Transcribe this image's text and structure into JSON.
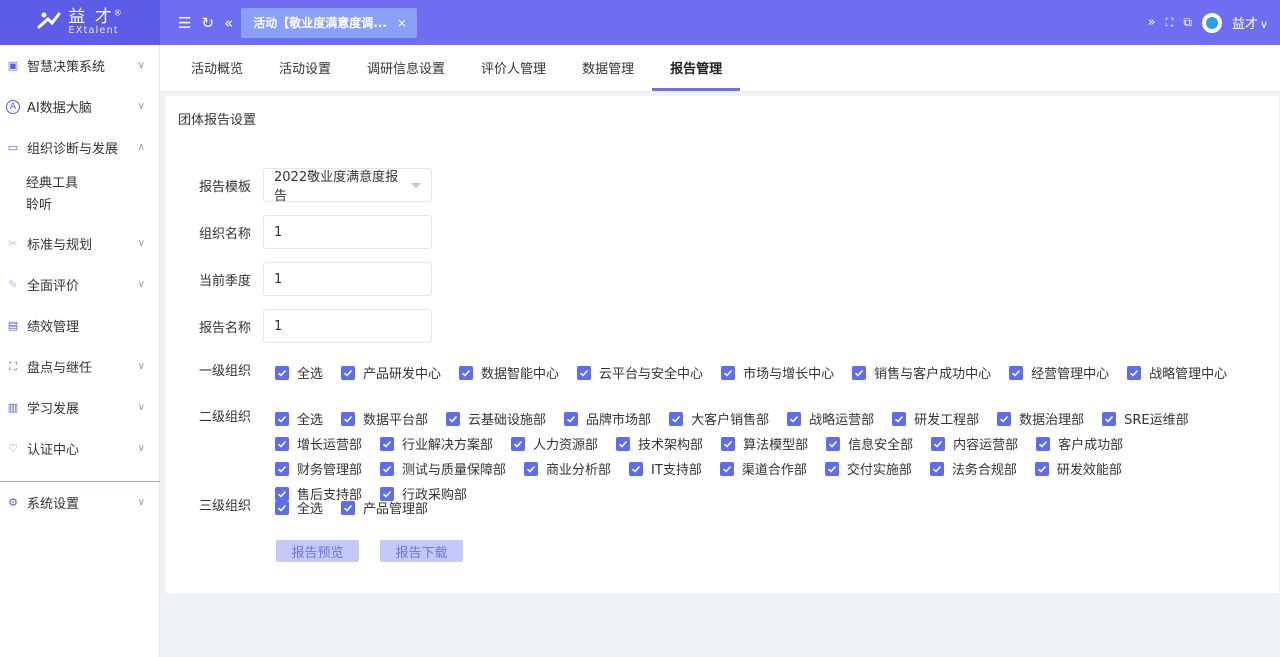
{
  "header": {
    "logo_cn": "益 才",
    "logo_en": "EXtalent",
    "logo_mark": "®",
    "menu_icon": "menu-fold-icon",
    "refresh_icon": "refresh-icon",
    "back_icon": "double-left-icon",
    "active_tab": "活动【敬业度满意度调...",
    "close_glyph": "×",
    "right_icons": [
      "double-right-icon",
      "fullscreen-icon",
      "translate-icon"
    ],
    "user_name": "益才",
    "user_caret": "∨"
  },
  "sidebar": {
    "items": [
      {
        "label": "智慧决策系统",
        "icon": "dashboard-icon",
        "chevron": "∨"
      },
      {
        "label": "AI数据大脑",
        "icon": "ai-icon",
        "chevron": "∨"
      },
      {
        "label": "组织诊断与发展",
        "icon": "monitor-icon",
        "chevron": "∧"
      },
      {
        "label": "标准与规划",
        "icon": "scissors-icon",
        "chevron": "∨"
      },
      {
        "label": "全面评价",
        "icon": "edit-icon",
        "chevron": "∨"
      },
      {
        "label": "绩效管理",
        "icon": "chart-icon",
        "chevron": ""
      },
      {
        "label": "盘点与继任",
        "icon": "org-icon",
        "chevron": "∨"
      },
      {
        "label": "学习发展",
        "icon": "book-icon",
        "chevron": "∨"
      },
      {
        "label": "认证中心",
        "icon": "badge-icon",
        "chevron": "∨"
      },
      {
        "label": "系统设置",
        "icon": "settings-icon",
        "chevron": "∨"
      }
    ],
    "subitems": [
      "经典工具",
      "聆听"
    ]
  },
  "subnav": {
    "tabs": [
      "活动概览",
      "活动设置",
      "调研信息设置",
      "评价人管理",
      "数据管理",
      "报告管理"
    ]
  },
  "card": {
    "title": "团体报告设置",
    "template_label": "报告模板",
    "template_value": "2022敬业度满意度报告",
    "org_label": "组织名称",
    "org_value": "1",
    "quarter_label": "当前季度",
    "quarter_value": "1",
    "report_label": "报告名称",
    "report_value": "1",
    "level1_label": "一级组织",
    "level1": [
      "全选",
      "产品研发中心",
      "数据智能中心",
      "云平台与安全中心",
      "市场与增长中心",
      "销售与客户成功中心",
      "经营管理中心",
      "战略管理中心"
    ],
    "level2_label": "二级组织",
    "level2": [
      "全选",
      "数据平台部",
      "云基础设施部",
      "品牌市场部",
      "大客户销售部",
      "战略运营部",
      "研发工程部",
      "数据治理部",
      "SRE运维部",
      "增长运营部",
      "行业解决方案部",
      "人力资源部",
      "技术架构部",
      "算法模型部",
      "信息安全部",
      "内容运营部",
      "客户成功部",
      "财务管理部",
      "测试与质量保障部",
      "商业分析部",
      "IT支持部",
      "渠道合作部",
      "交付实施部",
      "法务合规部",
      "研发效能部",
      "售后支持部",
      "行政采购部"
    ],
    "level3_label": "三级组织",
    "level3": [
      "全选",
      "产品管理部"
    ],
    "preview_button": "报告预览",
    "download_button": "报告下载"
  },
  "colors": {
    "brand": "#6f6ef0",
    "check": "#5e6cf0",
    "button_bg": "#c4caf7"
  }
}
